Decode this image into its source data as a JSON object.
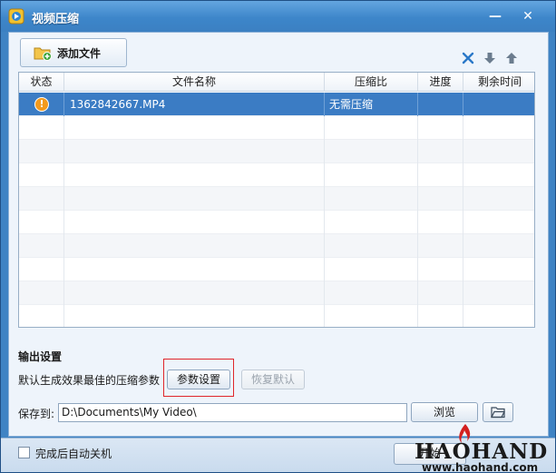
{
  "window": {
    "title": "视频压缩",
    "min_label": "—",
    "close_label": "✕"
  },
  "toolbar": {
    "add_file_label": "添加文件"
  },
  "table": {
    "columns": [
      "状态",
      "文件名称",
      "压缩比",
      "进度",
      "剩余时间"
    ],
    "rows": [
      {
        "status": "!",
        "filename": "1362842667.MP4",
        "ratio": "无需压缩",
        "progress": "",
        "remaining": ""
      }
    ]
  },
  "output": {
    "section_title": "输出设置",
    "hint": "默认生成效果最佳的压缩参数",
    "param_button": "参数设置",
    "reset_button": "恢复默认",
    "save_label": "保存到:",
    "save_path": "D:\\Documents\\My Video\\",
    "browse_button": "浏览"
  },
  "footer": {
    "auto_shutdown_label": "完成后自动关机",
    "start_button": "开始"
  },
  "watermark": {
    "brand": "HAOHAND",
    "url": "www.haohand.com"
  },
  "colors": {
    "titlebar": "#3d86ca",
    "selection": "#3b7cc4",
    "warning": "#f39a1d",
    "highlight_box": "#e0262b"
  }
}
